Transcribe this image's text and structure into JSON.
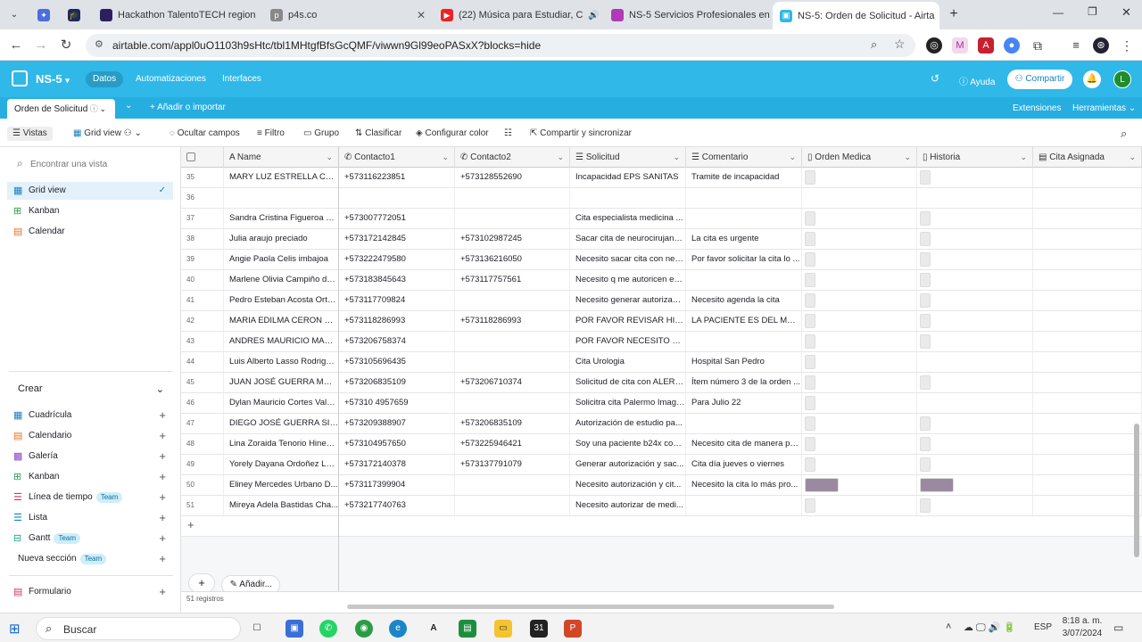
{
  "browser": {
    "tabs": [
      {
        "title": "",
        "icon": "shield-icon"
      },
      {
        "title": "",
        "icon": "sparkle-icon"
      },
      {
        "title": "",
        "icon": "graduation-icon"
      },
      {
        "title": "Hackathon TalentoTECH region",
        "icon": "hackathon-icon"
      },
      {
        "title": "p4s.co",
        "icon": "p4s-icon"
      },
      {
        "title": "(22) Música para Estudiar, C",
        "icon": "youtube-icon"
      },
      {
        "title": "NS-5 Servicios Profesionales en",
        "icon": "ns5-icon"
      },
      {
        "title": "NS-5: Orden de Solicitud - Airta",
        "icon": "airtable-icon"
      }
    ],
    "url": "airtable.com/appl0uO1103h9sHtc/tbl1MHtgfBfsGcQMF/viwwn9Gl99eoPASxX?blocks=hide"
  },
  "app": {
    "base_name": "NS-5",
    "nav": [
      "Datos",
      "Automatizaciones",
      "Interfaces"
    ],
    "help": "Ayuda",
    "share": "Compartir",
    "avatar": "L",
    "table_tab": "Orden de Solicitud",
    "add_import": "Añadir o importar",
    "extensions": "Extensiones",
    "tools": "Herramientas"
  },
  "viewbar": {
    "views": "Vistas",
    "grid_view": "Grid view",
    "hide_fields": "Ocultar campos",
    "filter": "Filtro",
    "group": "Grupo",
    "sort": "Clasificar",
    "color": "Configurar color",
    "share_sync": "Compartir y sincronizar"
  },
  "sidebar": {
    "search_placeholder": "Encontrar una vista",
    "views": [
      {
        "label": "Grid view",
        "icon": "grid-icon",
        "color": "#1a7fc2",
        "selected": true
      },
      {
        "label": "Kanban",
        "icon": "kanban-icon",
        "color": "#2e9e4f"
      },
      {
        "label": "Calendar",
        "icon": "calendar-icon",
        "color": "#e8762b"
      }
    ],
    "create_title": "Crear",
    "create_items": [
      {
        "label": "Cuadrícula",
        "icon": "grid-icon",
        "color": "#1a7fc2",
        "team": ""
      },
      {
        "label": "Calendario",
        "icon": "calendar-icon",
        "color": "#e8762b",
        "team": ""
      },
      {
        "label": "Galería",
        "icon": "gallery-icon",
        "color": "#8b46c7",
        "team": ""
      },
      {
        "label": "Kanban",
        "icon": "kanban-icon",
        "color": "#2e9e4f",
        "team": ""
      },
      {
        "label": "Línea de tiempo",
        "icon": "timeline-icon",
        "color": "#d2364a",
        "team": "Team"
      },
      {
        "label": "Lista",
        "icon": "list-icon",
        "color": "#1a7fc2",
        "team": ""
      },
      {
        "label": "Gantt",
        "icon": "gantt-icon",
        "color": "#14a39a",
        "team": "Team"
      },
      {
        "label": "Nueva sección",
        "icon": "",
        "color": "#1d1f25",
        "team": "Team"
      }
    ],
    "form": "Formulario"
  },
  "grid": {
    "columns": [
      "Name",
      "Contacto1",
      "Contacto2",
      "Solicitud",
      "Comentario",
      "Orden Medica",
      "Historia",
      "Cita Asignada"
    ],
    "rows": [
      {
        "n": "35",
        "name": "MARY LUZ ESTRELLA CARD...",
        "c1": "+573116223851",
        "c2": "+573128552690",
        "sol": "Incapacidad EPS SANITAS",
        "com": "Tramite de incapacidad",
        "om": 1,
        "hi": 1
      },
      {
        "n": "36",
        "name": "",
        "c1": "",
        "c2": "",
        "sol": "",
        "com": "",
        "om": 0,
        "hi": 0
      },
      {
        "n": "37",
        "name": "Sandra Cristina Figueroa D...",
        "c1": "+573007772051",
        "c2": "",
        "sol": "Cita especialista medicina ...",
        "com": "",
        "om": 1,
        "hi": 1
      },
      {
        "n": "38",
        "name": "Julia araujo preciado",
        "c1": "+573172142845",
        "c2": "+573102987245",
        "sol": "Sacar cita de neurocirujano...",
        "com": "La cita es urgente",
        "om": 1,
        "hi": 1
      },
      {
        "n": "39",
        "name": "Angie Paola Celis imbajoa",
        "c1": "+573222479580",
        "c2": "+573136216050",
        "sol": "Necesito sacar cita con neu...",
        "com": "Por favor solicitar la cita lo ...",
        "om": 1,
        "hi": 1
      },
      {
        "n": "40",
        "name": "Marlene Olivia Campiño de...",
        "c1": "+573183845643",
        "c2": "+573117757561",
        "sol": "Necesito q me autoricen ex...",
        "com": "",
        "om": 1,
        "hi": 1
      },
      {
        "n": "41",
        "name": "Pedro Esteban Acosta Orte...",
        "c1": "+573117709824",
        "c2": "",
        "sol": "Necesito generar autorizaci...",
        "com": "Necesito agenda la cita",
        "om": 1,
        "hi": 1
      },
      {
        "n": "42",
        "name": "MARIA EDILMA CERON GO...",
        "c1": "+573118286993",
        "c2": "+573118286993",
        "sol": "POR FAVOR REVISAR HIST...",
        "com": "LA PACIENTE ES DEL MUNI...",
        "om": 1,
        "hi": 1
      },
      {
        "n": "43",
        "name": "ANDRES MAURICIO MARTI...",
        "c1": "+573206758374",
        "c2": "",
        "sol": "POR FAVOR NECESITO QUE...",
        "com": "",
        "om": 1,
        "hi": 1
      },
      {
        "n": "44",
        "name": "Luis Alberto Lasso Rodriguez",
        "c1": "+573105696435",
        "c2": "",
        "sol": "Cita Urologia",
        "com": "Hospital San Pedro",
        "om": 1,
        "hi": 0
      },
      {
        "n": "45",
        "name": "JUAN JOSÉ GUERRA MORA...",
        "c1": "+573206835109",
        "c2": "+573206710374",
        "sol": "Solicitud de cita con ALERG...",
        "com": "Ítem número 3 de la orden ...",
        "om": 1,
        "hi": 1
      },
      {
        "n": "46",
        "name": "Dylan Mauricio Cortes Vale...",
        "c1": "+57310 4957659",
        "c2": "",
        "sol": "Solicitra cita Palermo Imagen",
        "com": "Para Julio 22",
        "om": 1,
        "hi": 0
      },
      {
        "n": "47",
        "name": "DIEGO JOSÉ GUERRA SILVA",
        "c1": "+573209388907",
        "c2": "+573206835109",
        "sol": "Autorización de estudio pa...",
        "com": "",
        "om": 1,
        "hi": 1
      },
      {
        "n": "48",
        "name": "Lina Zoraida Tenorio Hinest...",
        "c1": "+573104957650",
        "c2": "+573225946421",
        "sol": "Soy una paciente b24x con ...",
        "com": "Necesito cita de manera pri...",
        "om": 1,
        "hi": 1
      },
      {
        "n": "49",
        "name": "Yorely Dayana Ordoñez Lat...",
        "c1": "+573172140378",
        "c2": "+573137791079",
        "sol": "Generar autorización y sac...",
        "com": "Cita día jueves o viernes",
        "om": 1,
        "hi": 1
      },
      {
        "n": "50",
        "name": "Eliney Mercedes Urbano D...",
        "c1": "+573117399904",
        "c2": "",
        "sol": "Necesito autorización y cit...",
        "com": "Necesito la cita lo más pro...",
        "om": 2,
        "hi": 2
      },
      {
        "n": "51",
        "name": "Mireya Adela Bastidas Cha...",
        "c1": "+573217740763",
        "c2": "",
        "sol": "Necesito autorizar de medi...",
        "com": "",
        "om": 1,
        "hi": 1
      }
    ],
    "add_label": "Añadir...",
    "record_count": "51 registros"
  },
  "taskbar": {
    "search": "Buscar",
    "lang": "ESP",
    "time": "8:18 a. m.",
    "date": "3/07/2024"
  }
}
